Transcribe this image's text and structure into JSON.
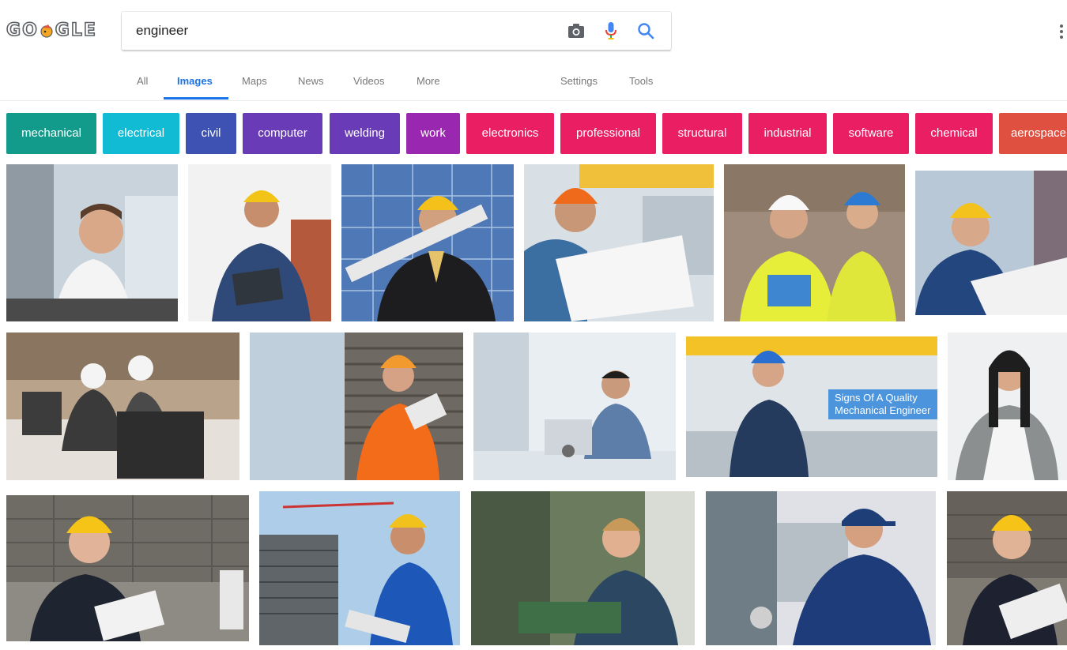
{
  "logo": {
    "letters": [
      "G",
      "O",
      "G",
      "L",
      "E"
    ],
    "doodle_icon": "doodle-icon"
  },
  "search": {
    "value": "engineer",
    "placeholder": ""
  },
  "icons": {
    "camera": "camera-icon",
    "mic": "microphone-icon",
    "search": "search-icon",
    "menu": "more-vert-icon"
  },
  "tabs": [
    {
      "label": "All",
      "active": false
    },
    {
      "label": "Images",
      "active": true
    },
    {
      "label": "Maps",
      "active": false
    },
    {
      "label": "News",
      "active": false
    },
    {
      "label": "Videos",
      "active": false
    },
    {
      "label": "More",
      "active": false
    },
    {
      "label": "Settings",
      "active": false
    },
    {
      "label": "Tools",
      "active": false
    }
  ],
  "chips": [
    {
      "label": "mechanical",
      "color": "#129a8b"
    },
    {
      "label": "electrical",
      "color": "#10bbd3"
    },
    {
      "label": "civil",
      "color": "#3d52b2"
    },
    {
      "label": "computer",
      "color": "#6a3bb7"
    },
    {
      "label": "welding",
      "color": "#6a3bb7"
    },
    {
      "label": "work",
      "color": "#9a27b0"
    },
    {
      "label": "electronics",
      "color": "#e91e63"
    },
    {
      "label": "professional",
      "color": "#e91e63"
    },
    {
      "label": "structural",
      "color": "#e91e63"
    },
    {
      "label": "industrial",
      "color": "#e91e63"
    },
    {
      "label": "software",
      "color": "#e91e63"
    },
    {
      "label": "chemical",
      "color": "#e91e63"
    },
    {
      "label": "aerospace",
      "color": "#e05040"
    }
  ],
  "image_caption": "Signs Of A Quality Mechanical Engineer"
}
